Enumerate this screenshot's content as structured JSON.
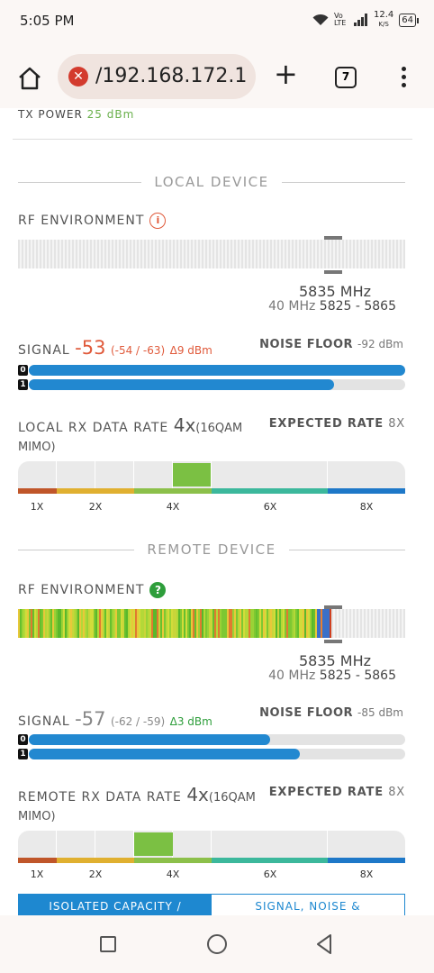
{
  "status": {
    "time": "5:05 PM",
    "net_speed": "12.4",
    "net_unit": "K/S",
    "battery": "64",
    "vo_lte": "Vo LTE"
  },
  "browser": {
    "url": "/192.168.172.1",
    "tab_count": "7"
  },
  "top_cut_label": "TX POWER",
  "top_cut_value": "25 dBm",
  "local": {
    "section_title": "LOCAL DEVICE",
    "rf_label": "RF ENVIRONMENT",
    "rf_icon": "i",
    "freq": "5835 MHz",
    "width": "40 MHz",
    "range": "5825 - 5865",
    "signal_label": "SIGNAL",
    "signal_value": "-53",
    "signal_detail": "(-54 / -63)",
    "signal_delta": "Δ9 dBm",
    "noise_label": "NOISE FLOOR",
    "noise_value": "-92 dBm",
    "chain0_level": 1.0,
    "chain1_level": 0.81,
    "rate_label": "LOCAL RX DATA RATE",
    "rate_value": "4x",
    "rate_detail": "(16QAM",
    "rate_detail2": "MIMO)",
    "expected_label": "EXPECTED RATE",
    "expected_value": "8X",
    "scale": [
      "1X",
      "2X",
      "4X",
      "6X",
      "8X"
    ]
  },
  "remote": {
    "section_title": "REMOTE DEVICE",
    "rf_label": "RF ENVIRONMENT",
    "rf_icon": "?",
    "freq": "5835 MHz",
    "width": "40 MHz",
    "range": "5825 - 5865",
    "signal_label": "SIGNAL",
    "signal_value": "-57",
    "signal_detail": "(-62 / -59)",
    "signal_delta": "Δ3 dBm",
    "noise_label": "NOISE FLOOR",
    "noise_value": "-85 dBm",
    "chain0_level": 0.64,
    "chain1_level": 0.72,
    "rate_label": "REMOTE RX DATA RATE",
    "rate_value": "4x",
    "rate_detail": "(16QAM",
    "rate_detail2": "MIMO)",
    "expected_label": "EXPECTED RATE",
    "expected_value": "8X",
    "scale": [
      "1X",
      "2X",
      "4X",
      "6X",
      "8X"
    ]
  },
  "bottom_tabs": {
    "left": "ISOLATED CAPACITY /",
    "right": "SIGNAL, NOISE &"
  },
  "colors": {
    "accent": "#1e88d0",
    "signal_local": "#e05a3b",
    "delta_local": "#e05a3b",
    "signal_remote": "#888888",
    "delta_remote": "#2e9e3b",
    "active_rate": "#7bc043"
  }
}
